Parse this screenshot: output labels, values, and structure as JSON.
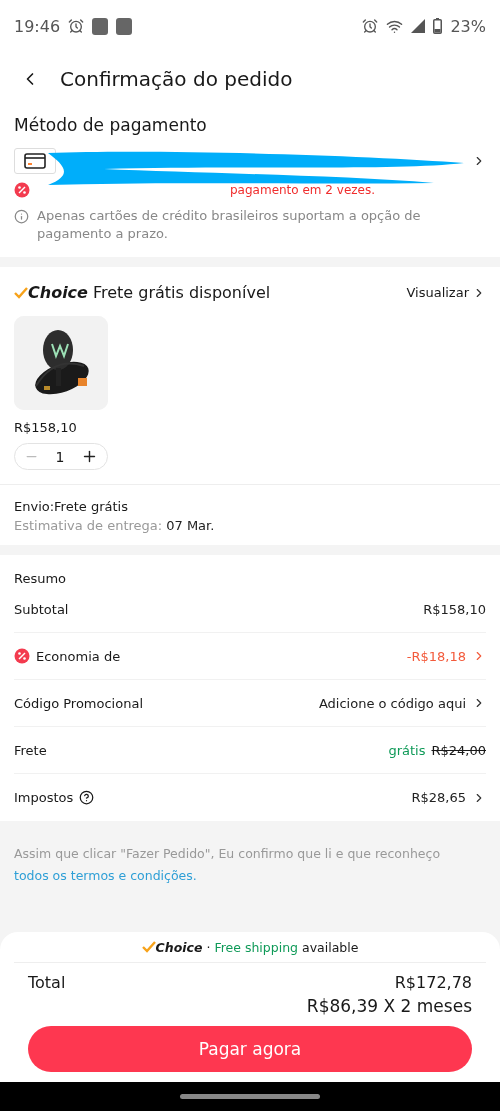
{
  "status_bar": {
    "time": "19:46",
    "battery": "23%"
  },
  "header": {
    "title": "Confirmação do pedido"
  },
  "payment": {
    "title": "Método de pagamento",
    "installment_note": "pagamento em 2 vezes.",
    "info": "Apenas cartões de crédito brasileiros suportam a opção de pagamento a prazo."
  },
  "shipping_group": {
    "badge": "Choice",
    "title": "Frete grátis disponível",
    "link": "Visualizar",
    "items": [
      {
        "kind": "picture",
        "price": "R$158,10",
        "quantity": "1"
      }
    ],
    "delivery": {
      "method": "Envio:Frete grátis",
      "estimate_label": "Estimativa de entrega:",
      "estimate_date": "07 Mar."
    }
  },
  "summary": {
    "title": "Resumo",
    "rows": [
      {
        "kind": "plain",
        "label": "Subtotal",
        "value": "R$158,10"
      },
      {
        "kind": "discount",
        "label": "Economia de",
        "value": "-R$18,18"
      },
      {
        "kind": "link",
        "label": "Código Promocional",
        "value": "Adicione o código aqui"
      },
      {
        "kind": "shipping",
        "label": "Frete",
        "value": "grátis",
        "old_value": "R$24,00"
      },
      {
        "kind": "tax",
        "label": "Impostos",
        "value": "R$28,65"
      }
    ]
  },
  "terms": {
    "text": "Assim que clicar \"Fazer Pedido\", Eu confirmo que li e que reconheço",
    "link": "todos os termos e condições."
  },
  "checkout": {
    "badge": "Choice",
    "separator": "·",
    "free_text": "Free shipping",
    "available": "available",
    "total_label": "Total",
    "total": "R$172,78",
    "installments": "R$86,39 X 2 meses",
    "button": "Pagar agora"
  }
}
